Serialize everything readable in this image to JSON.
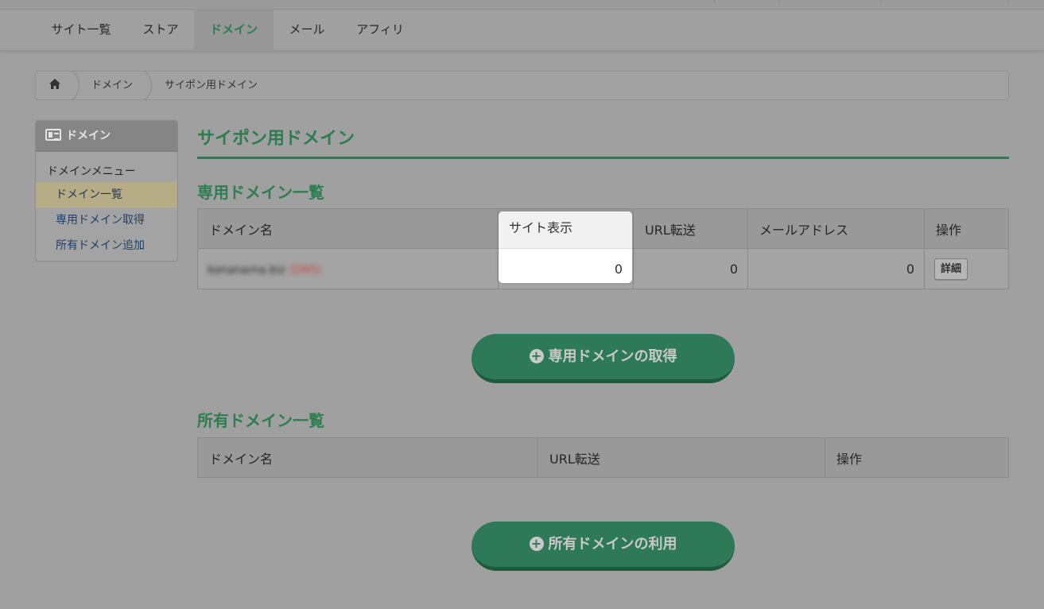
{
  "nav": {
    "items": [
      {
        "label": "サイト一覧"
      },
      {
        "label": "ストア"
      },
      {
        "label": "ドメイン"
      },
      {
        "label": "メール"
      },
      {
        "label": "アフィリ"
      }
    ]
  },
  "breadcrumb": {
    "items": [
      "ドメイン",
      "サイポン用ドメイン"
    ]
  },
  "sidebar": {
    "header": "ドメイン",
    "menu_title": "ドメインメニュー",
    "links": [
      "ドメイン一覧",
      "専用ドメイン取得",
      "所有ドメイン追加"
    ]
  },
  "page": {
    "title": "サイポン用ドメイン"
  },
  "dedicated": {
    "title": "専用ドメイン一覧",
    "columns": [
      "ドメイン名",
      "サイト表示",
      "URL転送",
      "メールアドレス",
      "操作"
    ],
    "row": {
      "domain": "konanama.biz",
      "domain_tag": "(DNS)",
      "site_count": "0",
      "url_count": "0",
      "mail_count": "0",
      "action": "詳細"
    },
    "button": "専用ドメインの取得"
  },
  "owned": {
    "title": "所有ドメイン一覧",
    "columns": [
      "ドメイン名",
      "URL転送",
      "操作"
    ],
    "button": "所有ドメインの利用"
  },
  "colors": {
    "accent": "#2e7d50",
    "button": "#2e7a58"
  }
}
